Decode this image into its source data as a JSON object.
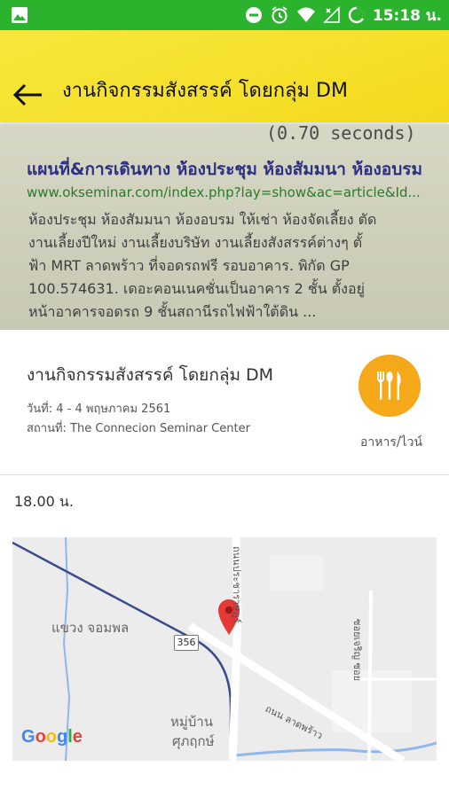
{
  "status_bar": {
    "time": "15:18 น.",
    "icons": [
      "image-icon",
      "do-not-disturb-icon",
      "alarm-icon",
      "wifi-icon",
      "signal-icon",
      "battery-icon"
    ]
  },
  "app_bar": {
    "title": "งานกิจกรรมสังสรรค์ โดยกลุ่ม DM",
    "back_icon": "arrow-back-icon",
    "background": "#f6e02a"
  },
  "hero": {
    "lines": [
      "(0.70 seconds)",
      "แผนที่&การเดินทาง ห้องประชุม ห้องสัมมนา ห้องอบรม",
      "www.okseminar.com/index.php?lay=show&ac=article&Id...",
      "ห้องประชุม ห้องสัมมนา ห้องอบรม ให้เช่า ห้องจัดเลี้ยง ตัด",
      "งานเลี้ยงปีใหม่ งานเลี้ยงบริษัท งานเลี้ยงสังสรรค์ต่างๆ ตั้",
      "ฟ้า MRT ลาดพร้าว ที่จอดรถฟรี รอบอาคาร. พิกัด GP",
      "100.574631. เดอะคอนเนคชั่นเป็นอาคาร 2 ชั้น ตั้งอยู่",
      "หน้าอาคารจอดรถ 9 ชั้นสถานีรถไฟฟ้าใต้ดิน ..."
    ]
  },
  "event": {
    "name": "งานกิจกรรมสังสรรค์ โดยกลุ่ม DM",
    "date": "วันที่: 4 - 4 พฤษภาคม 2561",
    "venue": "สถานที่: The Connecion Seminar Center",
    "category_label": "อาหาร/ไวน์",
    "category_icon": "restaurant-icon",
    "category_color": "#f6a81b",
    "time": "18.00 น."
  },
  "map": {
    "district_label": "แขวง จอมพล",
    "village_label_1": "หมู่บ้าน",
    "village_label_2": "ศุภฤกษ์",
    "route_number": "356",
    "road_1": "ถนนประชาราษฎร์",
    "road_2": "ถนน ลาดพร้าว",
    "road_3": "ซอยเจริญ ซอย",
    "logo": "Google",
    "pin_color": "#e53935"
  }
}
